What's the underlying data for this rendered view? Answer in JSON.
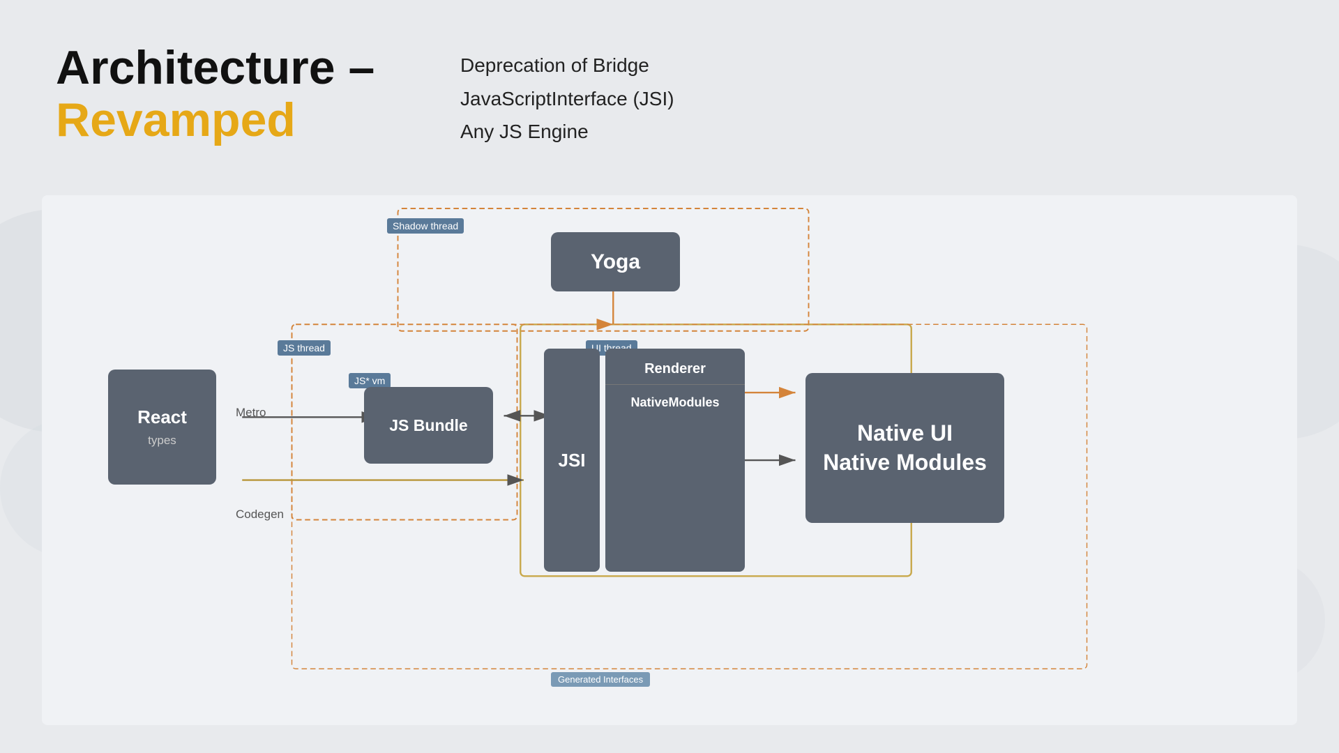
{
  "title": {
    "line1": "Architecture –",
    "line2": "Revamped"
  },
  "bullets": [
    "Deprecation of Bridge",
    "JavaScriptInterface (JSI)",
    "Any JS Engine"
  ],
  "diagram": {
    "shadow_thread": "Shadow thread",
    "js_thread": "JS thread",
    "ui_thread": "UI thread",
    "jsvm_label": "JS* vm",
    "yoga_label": "Yoga",
    "react_label": "React",
    "react_sub": "types",
    "jsbundle_label": "JS Bundle",
    "jsi_label": "JSI",
    "renderer_label": "Renderer",
    "nativemodules_label": "NativeModules",
    "native_ui_line1": "Native UI",
    "native_ui_line2": "Native Modules",
    "metro_label": "Metro",
    "codegen_label": "Codegen",
    "generated_interfaces": "Generated Interfaces"
  },
  "colors": {
    "accent": "#e6a817",
    "box_bg": "#5a6370",
    "thread_label": "#5a7a99",
    "dashed_orange": "#d4843a",
    "dashed_gray": "#999",
    "arrow_orange": "#d4843a",
    "arrow_dark": "#555"
  }
}
